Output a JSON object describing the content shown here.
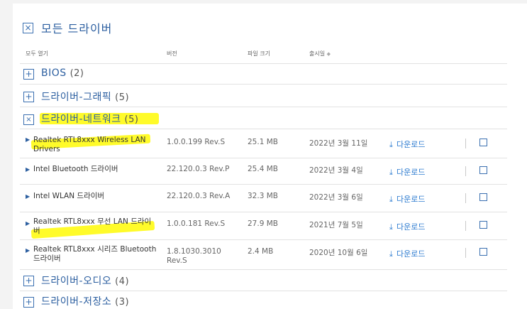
{
  "page": {
    "title": "모든 드라이버"
  },
  "header": {
    "expand_all": "모두 열기",
    "version": "버전",
    "file_size": "파일 크기",
    "release_date": "출시일"
  },
  "categories": [
    {
      "label": "BIOS",
      "count": "(2)",
      "expanded": false
    },
    {
      "label": "드라이버-그래픽",
      "count": "(5)",
      "expanded": false
    },
    {
      "label": "드라이버-네트워크",
      "count": "(5)",
      "expanded": true
    },
    {
      "label": "드라이버-오디오",
      "count": "(4)",
      "expanded": false
    },
    {
      "label": "드라이버-저장소",
      "count": "(3)",
      "expanded": false
    }
  ],
  "download_label": "다운로드",
  "drivers": [
    {
      "name": "Realtek RTL8xxx Wireless LAN Drivers",
      "version": "1.0.0.199 Rev.S",
      "size": "25.1 MB",
      "date": "2022년 3월 11일"
    },
    {
      "name": "Intel Bluetooth 드라이버",
      "version": "22.120.0.3 Rev.P",
      "size": "25.4 MB",
      "date": "2022년 3월 4일"
    },
    {
      "name": "Intel WLAN 드라이버",
      "version": "22.120.0.3 Rev.A",
      "size": "32.3 MB",
      "date": "2022년 3월 6일"
    },
    {
      "name": "Realtek RTL8xxx 무선 LAN 드라이버",
      "version": "1.0.0.181 Rev.S",
      "size": "27.9 MB",
      "date": "2021년 7월 5일"
    },
    {
      "name": "Realtek RTL8xxx 시리즈 Bluetooth 드라이버",
      "version": "1.8.1030.3010 Rev.S",
      "size": "2.4 MB",
      "date": "2020년 10월 6일"
    }
  ],
  "icons": {
    "collapse": "x-box-icon",
    "expand": "plus-box-icon",
    "download": "download-tray-icon",
    "row_toggle": "triangle-right-icon"
  },
  "colors": {
    "accent": "#2c5fa0",
    "link": "#2c7bd0",
    "highlight": "#fffb2a"
  }
}
